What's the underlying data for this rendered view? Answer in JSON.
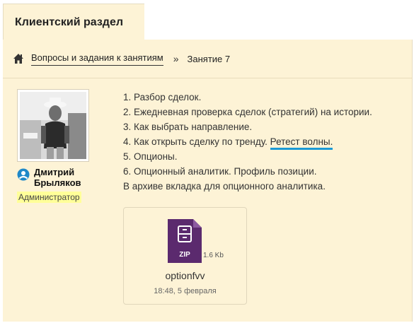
{
  "tab": {
    "title": "Клиентский раздел"
  },
  "breadcrumb": {
    "link": "Вопросы и задания к занятиям",
    "separator": "»",
    "current": "Занятие 7"
  },
  "author": {
    "name": "Дмитрий Брыляков",
    "role": "Администратор"
  },
  "content": {
    "lines": [
      "1. Разбор сделок.",
      "2. Ежедневная проверка сделок (стратегий) на истории.",
      "3. Как выбрать направление.",
      "4. Как открыть сделку по тренду.",
      "5. Опционы.",
      "6. Опционный аналитик. Профиль позиции.",
      "В архиве вкладка для опционного аналитика."
    ],
    "highlight": "Ретест волны."
  },
  "attachment": {
    "type_label": "ZIP",
    "size": "1.6 Kb",
    "name": "optionfvv",
    "date": "18:48, 5 февраля"
  },
  "colors": {
    "panel_bg": "#fdf3d6",
    "highlight_underline": "#1a9ad6",
    "role_badge": "#ffff99",
    "file_icon": "#5b2a6e"
  },
  "icons": [
    "home-icon",
    "user-icon",
    "zip-file-icon"
  ]
}
